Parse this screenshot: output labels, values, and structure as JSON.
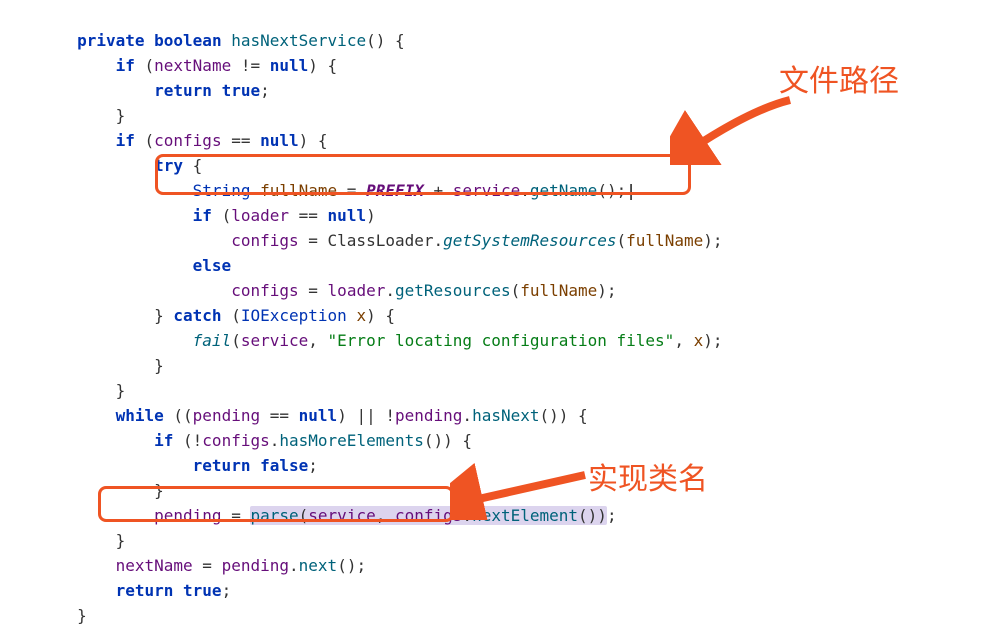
{
  "annotation": {
    "file_path_label": "文件路径",
    "impl_class_label": "实现类名"
  },
  "code": {
    "l1_private": "private",
    "l1_boolean": "boolean",
    "l1_method": "hasNextService",
    "l2_if": "if",
    "l2_nextname": "nextName",
    "l2_null": "null",
    "l3_return": "return",
    "l3_true": "true",
    "l5_if": "if",
    "l5_configs": "configs",
    "l5_null": "null",
    "l6_try": "try",
    "l7_string": "String",
    "l7_fullname": "fullName",
    "l7_prefix": "PREFIX",
    "l7_service": "service",
    "l7_getname": "getName",
    "l8_if": "if",
    "l8_loader": "loader",
    "l8_null": "null",
    "l9_configs": "configs",
    "l9_classloader": "ClassLoader",
    "l9_getsys": "getSystemResources",
    "l9_fullname": "fullName",
    "l10_else": "else",
    "l11_configs": "configs",
    "l11_loader": "loader",
    "l11_getres": "getResources",
    "l11_fullname": "fullName",
    "l12_catch": "catch",
    "l12_ioe": "IOException",
    "l12_x": "x",
    "l13_fail": "fail",
    "l13_service": "service",
    "l13_msg": "\"Error locating configuration files\"",
    "l13_x": "x",
    "l16_while": "while",
    "l16_pending1": "pending",
    "l16_null": "null",
    "l16_pending2": "pending",
    "l16_hasnext": "hasNext",
    "l17_if": "if",
    "l17_configs": "configs",
    "l17_hasmore": "hasMoreElements",
    "l18_return": "return",
    "l18_false": "false",
    "l20_pending": "pending",
    "l20_parse": "parse",
    "l20_service": "service",
    "l20_configs": "configs",
    "l20_nextel": "nextElement",
    "l22_nextname": "nextName",
    "l22_pending": "pending",
    "l22_next": "next",
    "l23_return": "return",
    "l23_true": "true"
  }
}
